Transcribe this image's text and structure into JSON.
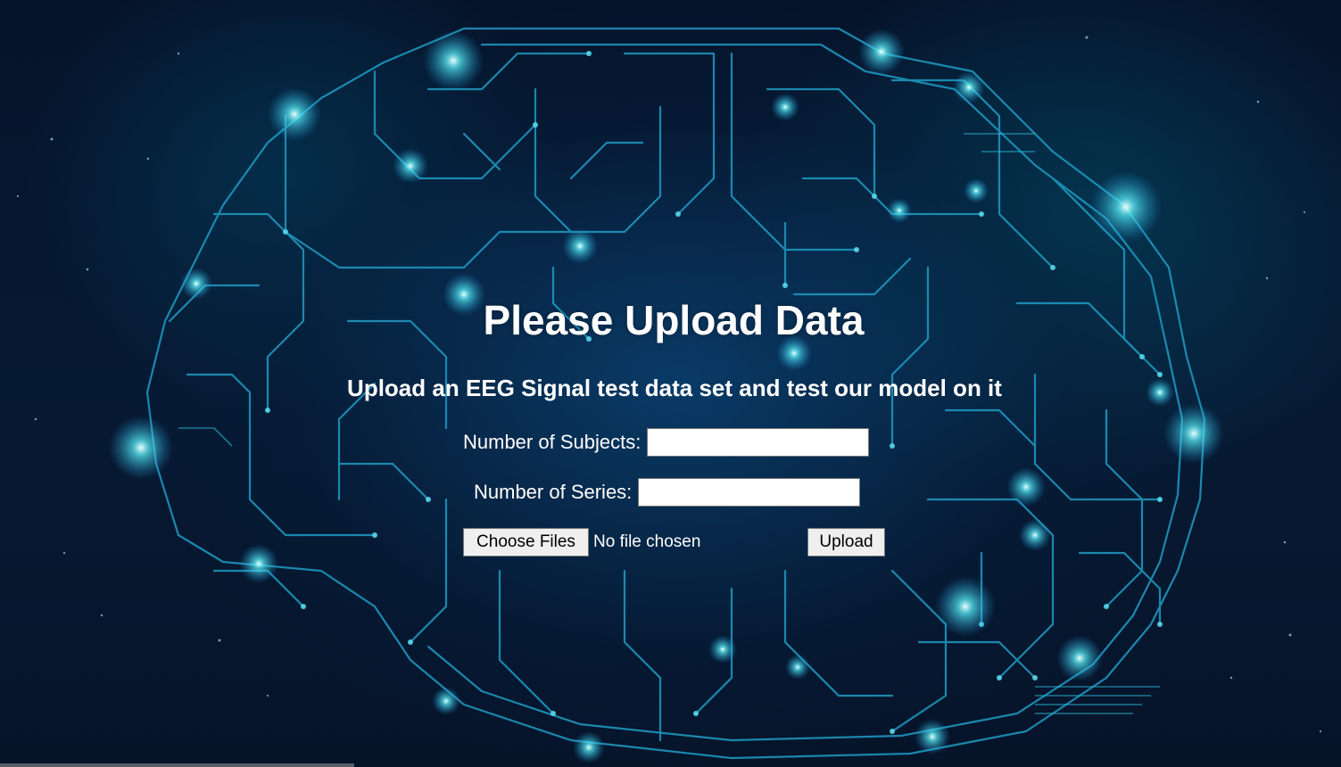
{
  "page": {
    "title": "Please Upload Data",
    "subtitle": "Upload an EEG Signal test data set and test our model on it"
  },
  "form": {
    "subjects_label": "Number of Subjects:",
    "subjects_value": "",
    "series_label": "Number of Series:",
    "series_value": "",
    "choose_files_label": "Choose Files",
    "file_status": "No file chosen",
    "upload_label": "Upload"
  },
  "background": {
    "image": "circuit-brain",
    "accent_color": "#1fa3c9",
    "glow_color": "#39e6f0"
  }
}
